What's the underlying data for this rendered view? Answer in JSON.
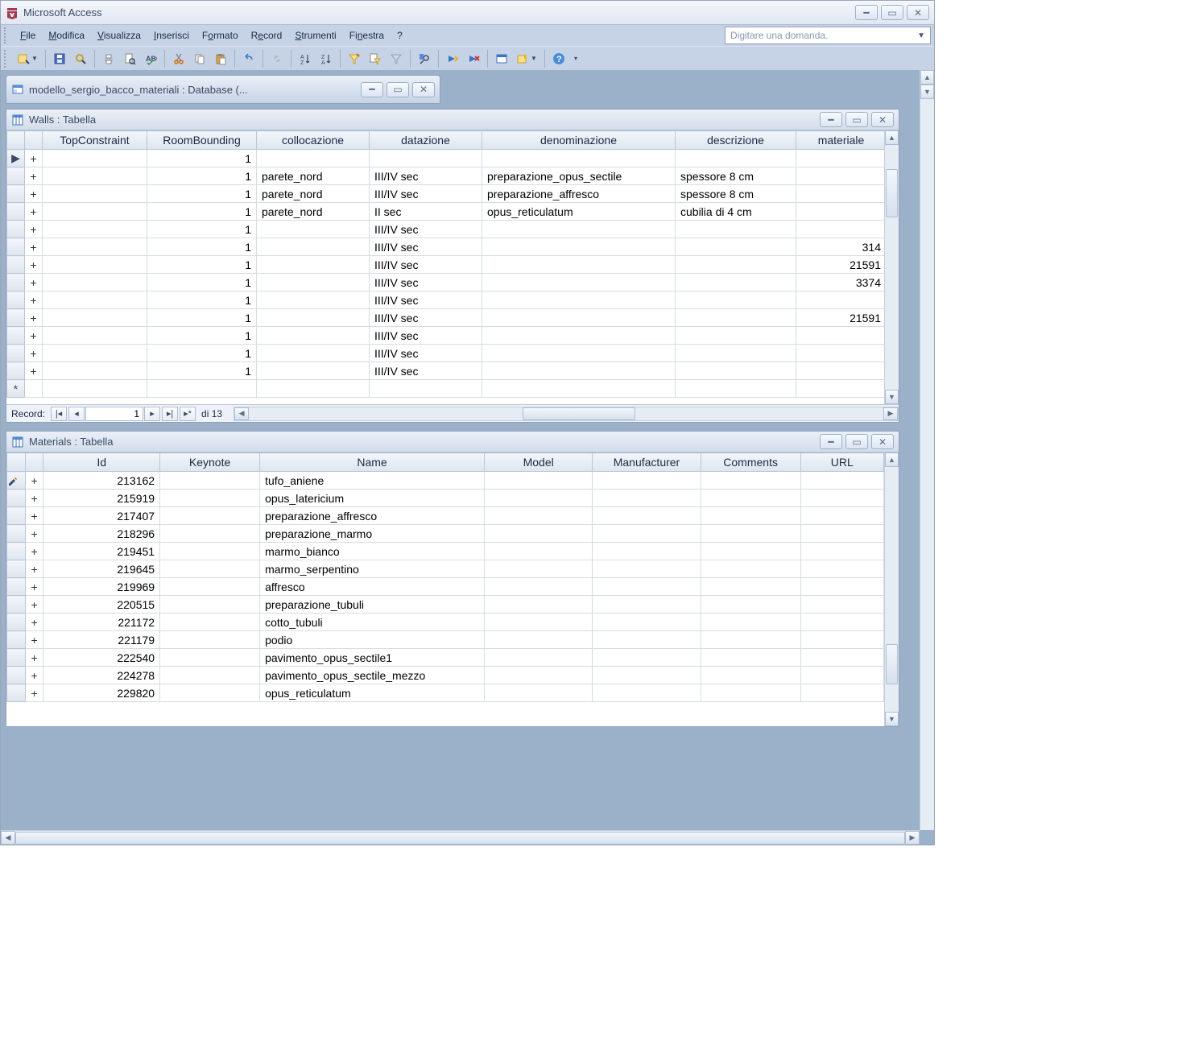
{
  "app": {
    "title": "Microsoft Access",
    "help_placeholder": "Digitare una domanda."
  },
  "menus": {
    "file": "File",
    "edit": "Modifica",
    "view": "Visualizza",
    "insert": "Inserisci",
    "format": "Formato",
    "record": "Record",
    "tools": "Strumenti",
    "window": "Finestra",
    "help": "?"
  },
  "db_window": {
    "title": "modello_sergio_bacco_materiali : Database (..."
  },
  "walls": {
    "title": "Walls : Tabella",
    "headers": {
      "top_constraint": "TopConstraint",
      "room_bounding": "RoomBounding",
      "collocazione": "collocazione",
      "datazione": "datazione",
      "denominazione": "denominazione",
      "descrizione": "descrizione",
      "materiale": "materiale"
    },
    "rows": [
      {
        "tc": "",
        "rb": "1",
        "col": "",
        "dat": "",
        "den": "",
        "des": "",
        "mat": ""
      },
      {
        "tc": "",
        "rb": "1",
        "col": "parete_nord",
        "dat": "III/IV sec",
        "den": "preparazione_opus_sectile",
        "des": "spessore 8 cm",
        "mat": ""
      },
      {
        "tc": "",
        "rb": "1",
        "col": "parete_nord",
        "dat": "III/IV sec",
        "den": "preparazione_affresco",
        "des": "spessore 8 cm",
        "mat": ""
      },
      {
        "tc": "",
        "rb": "1",
        "col": "parete_nord",
        "dat": "II sec",
        "den": "opus_reticulatum",
        "des": "cubilia di 4 cm",
        "mat": ""
      },
      {
        "tc": "",
        "rb": "1",
        "col": "",
        "dat": "III/IV sec",
        "den": "",
        "des": "",
        "mat": ""
      },
      {
        "tc": "",
        "rb": "1",
        "col": "",
        "dat": "III/IV sec",
        "den": "",
        "des": "",
        "mat": "314"
      },
      {
        "tc": "",
        "rb": "1",
        "col": "",
        "dat": "III/IV sec",
        "den": "",
        "des": "",
        "mat": "21591"
      },
      {
        "tc": "",
        "rb": "1",
        "col": "",
        "dat": "III/IV sec",
        "den": "",
        "des": "",
        "mat": "3374"
      },
      {
        "tc": "",
        "rb": "1",
        "col": "",
        "dat": "III/IV sec",
        "den": "",
        "des": "",
        "mat": ""
      },
      {
        "tc": "",
        "rb": "1",
        "col": "",
        "dat": "III/IV sec",
        "den": "",
        "des": "",
        "mat": "21591"
      },
      {
        "tc": "",
        "rb": "1",
        "col": "",
        "dat": "III/IV sec",
        "den": "",
        "des": "",
        "mat": ""
      },
      {
        "tc": "",
        "rb": "1",
        "col": "",
        "dat": "III/IV sec",
        "den": "",
        "des": "",
        "mat": ""
      },
      {
        "tc": "",
        "rb": "1",
        "col": "",
        "dat": "III/IV sec",
        "den": "",
        "des": "",
        "mat": ""
      }
    ],
    "recnav": {
      "label": "Record:",
      "current": "1",
      "of_text": "di 13"
    }
  },
  "materials": {
    "title": "Materials : Tabella",
    "headers": {
      "id": "Id",
      "keynote": "Keynote",
      "name": "Name",
      "model": "Model",
      "manufacturer": "Manufacturer",
      "comments": "Comments",
      "url": "URL"
    },
    "rows": [
      {
        "id": "213162",
        "kn": "",
        "name": "tufo_aniene",
        "model": "",
        "mfg": "",
        "cm": "",
        "url": ""
      },
      {
        "id": "215919",
        "kn": "",
        "name": "opus_latericium",
        "model": "",
        "mfg": "",
        "cm": "",
        "url": ""
      },
      {
        "id": "217407",
        "kn": "",
        "name": "preparazione_affresco",
        "model": "",
        "mfg": "",
        "cm": "",
        "url": ""
      },
      {
        "id": "218296",
        "kn": "",
        "name": "preparazione_marmo",
        "model": "",
        "mfg": "",
        "cm": "",
        "url": ""
      },
      {
        "id": "219451",
        "kn": "",
        "name": "marmo_bianco",
        "model": "",
        "mfg": "",
        "cm": "",
        "url": ""
      },
      {
        "id": "219645",
        "kn": "",
        "name": "marmo_serpentino",
        "model": "",
        "mfg": "",
        "cm": "",
        "url": ""
      },
      {
        "id": "219969",
        "kn": "",
        "name": "affresco",
        "model": "",
        "mfg": "",
        "cm": "",
        "url": ""
      },
      {
        "id": "220515",
        "kn": "",
        "name": "preparazione_tubuli",
        "model": "",
        "mfg": "",
        "cm": "",
        "url": ""
      },
      {
        "id": "221172",
        "kn": "",
        "name": "cotto_tubuli",
        "model": "",
        "mfg": "",
        "cm": "",
        "url": ""
      },
      {
        "id": "221179",
        "kn": "",
        "name": "podio",
        "model": "",
        "mfg": "",
        "cm": "",
        "url": ""
      },
      {
        "id": "222540",
        "kn": "",
        "name": "pavimento_opus_sectile1",
        "model": "",
        "mfg": "",
        "cm": "",
        "url": ""
      },
      {
        "id": "224278",
        "kn": "",
        "name": "pavimento_opus_sectile_mezzo",
        "model": "",
        "mfg": "",
        "cm": "",
        "url": ""
      },
      {
        "id": "229820",
        "kn": "",
        "name": "opus_reticulatum",
        "model": "",
        "mfg": "",
        "cm": "",
        "url": ""
      }
    ]
  }
}
